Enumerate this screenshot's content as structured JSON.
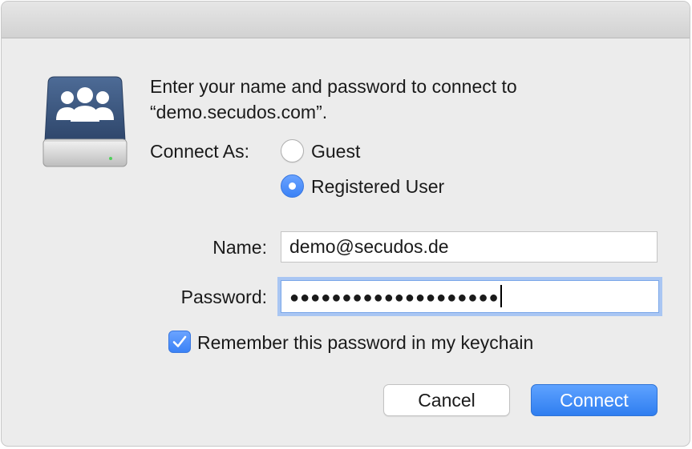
{
  "dialog": {
    "message_line1": "Enter your name and password to connect to",
    "message_line2": "“demo.secudos.com”."
  },
  "connect_as": {
    "label": "Connect As:",
    "options": [
      {
        "label": "Guest",
        "selected": false
      },
      {
        "label": "Registered User",
        "selected": true
      }
    ]
  },
  "name_field": {
    "label": "Name:",
    "value": "demo@secudos.de"
  },
  "password_field": {
    "label": "Password:",
    "value_masked": "●●●●●●●●●●●●●●●●●●●●",
    "focused": true
  },
  "remember_checkbox": {
    "label": "Remember this password in my keychain",
    "checked": true
  },
  "buttons": {
    "cancel": "Cancel",
    "connect": "Connect"
  },
  "colors": {
    "accent": "#3b82f6",
    "window_bg": "#ececec",
    "icon_blue": "#3a5680"
  }
}
